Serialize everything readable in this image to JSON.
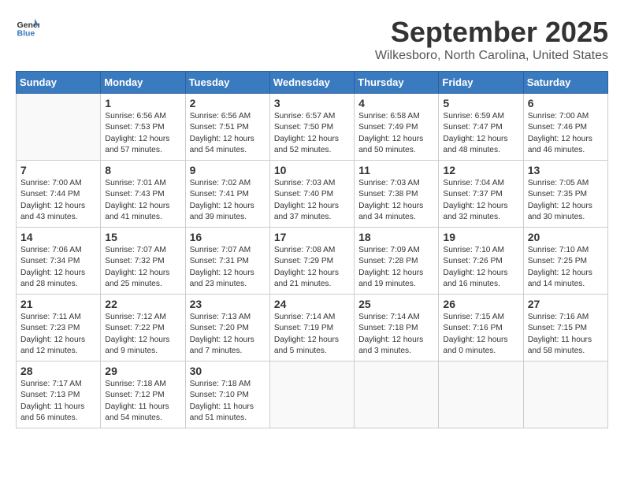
{
  "logo": {
    "general": "General",
    "blue": "Blue"
  },
  "title": "September 2025",
  "location": "Wilkesboro, North Carolina, United States",
  "weekdays": [
    "Sunday",
    "Monday",
    "Tuesday",
    "Wednesday",
    "Thursday",
    "Friday",
    "Saturday"
  ],
  "weeks": [
    [
      {
        "day": "",
        "info": ""
      },
      {
        "day": "1",
        "info": "Sunrise: 6:56 AM\nSunset: 7:53 PM\nDaylight: 12 hours\nand 57 minutes."
      },
      {
        "day": "2",
        "info": "Sunrise: 6:56 AM\nSunset: 7:51 PM\nDaylight: 12 hours\nand 54 minutes."
      },
      {
        "day": "3",
        "info": "Sunrise: 6:57 AM\nSunset: 7:50 PM\nDaylight: 12 hours\nand 52 minutes."
      },
      {
        "day": "4",
        "info": "Sunrise: 6:58 AM\nSunset: 7:49 PM\nDaylight: 12 hours\nand 50 minutes."
      },
      {
        "day": "5",
        "info": "Sunrise: 6:59 AM\nSunset: 7:47 PM\nDaylight: 12 hours\nand 48 minutes."
      },
      {
        "day": "6",
        "info": "Sunrise: 7:00 AM\nSunset: 7:46 PM\nDaylight: 12 hours\nand 46 minutes."
      }
    ],
    [
      {
        "day": "7",
        "info": "Sunrise: 7:00 AM\nSunset: 7:44 PM\nDaylight: 12 hours\nand 43 minutes."
      },
      {
        "day": "8",
        "info": "Sunrise: 7:01 AM\nSunset: 7:43 PM\nDaylight: 12 hours\nand 41 minutes."
      },
      {
        "day": "9",
        "info": "Sunrise: 7:02 AM\nSunset: 7:41 PM\nDaylight: 12 hours\nand 39 minutes."
      },
      {
        "day": "10",
        "info": "Sunrise: 7:03 AM\nSunset: 7:40 PM\nDaylight: 12 hours\nand 37 minutes."
      },
      {
        "day": "11",
        "info": "Sunrise: 7:03 AM\nSunset: 7:38 PM\nDaylight: 12 hours\nand 34 minutes."
      },
      {
        "day": "12",
        "info": "Sunrise: 7:04 AM\nSunset: 7:37 PM\nDaylight: 12 hours\nand 32 minutes."
      },
      {
        "day": "13",
        "info": "Sunrise: 7:05 AM\nSunset: 7:35 PM\nDaylight: 12 hours\nand 30 minutes."
      }
    ],
    [
      {
        "day": "14",
        "info": "Sunrise: 7:06 AM\nSunset: 7:34 PM\nDaylight: 12 hours\nand 28 minutes."
      },
      {
        "day": "15",
        "info": "Sunrise: 7:07 AM\nSunset: 7:32 PM\nDaylight: 12 hours\nand 25 minutes."
      },
      {
        "day": "16",
        "info": "Sunrise: 7:07 AM\nSunset: 7:31 PM\nDaylight: 12 hours\nand 23 minutes."
      },
      {
        "day": "17",
        "info": "Sunrise: 7:08 AM\nSunset: 7:29 PM\nDaylight: 12 hours\nand 21 minutes."
      },
      {
        "day": "18",
        "info": "Sunrise: 7:09 AM\nSunset: 7:28 PM\nDaylight: 12 hours\nand 19 minutes."
      },
      {
        "day": "19",
        "info": "Sunrise: 7:10 AM\nSunset: 7:26 PM\nDaylight: 12 hours\nand 16 minutes."
      },
      {
        "day": "20",
        "info": "Sunrise: 7:10 AM\nSunset: 7:25 PM\nDaylight: 12 hours\nand 14 minutes."
      }
    ],
    [
      {
        "day": "21",
        "info": "Sunrise: 7:11 AM\nSunset: 7:23 PM\nDaylight: 12 hours\nand 12 minutes."
      },
      {
        "day": "22",
        "info": "Sunrise: 7:12 AM\nSunset: 7:22 PM\nDaylight: 12 hours\nand 9 minutes."
      },
      {
        "day": "23",
        "info": "Sunrise: 7:13 AM\nSunset: 7:20 PM\nDaylight: 12 hours\nand 7 minutes."
      },
      {
        "day": "24",
        "info": "Sunrise: 7:14 AM\nSunset: 7:19 PM\nDaylight: 12 hours\nand 5 minutes."
      },
      {
        "day": "25",
        "info": "Sunrise: 7:14 AM\nSunset: 7:18 PM\nDaylight: 12 hours\nand 3 minutes."
      },
      {
        "day": "26",
        "info": "Sunrise: 7:15 AM\nSunset: 7:16 PM\nDaylight: 12 hours\nand 0 minutes."
      },
      {
        "day": "27",
        "info": "Sunrise: 7:16 AM\nSunset: 7:15 PM\nDaylight: 11 hours\nand 58 minutes."
      }
    ],
    [
      {
        "day": "28",
        "info": "Sunrise: 7:17 AM\nSunset: 7:13 PM\nDaylight: 11 hours\nand 56 minutes."
      },
      {
        "day": "29",
        "info": "Sunrise: 7:18 AM\nSunset: 7:12 PM\nDaylight: 11 hours\nand 54 minutes."
      },
      {
        "day": "30",
        "info": "Sunrise: 7:18 AM\nSunset: 7:10 PM\nDaylight: 11 hours\nand 51 minutes."
      },
      {
        "day": "",
        "info": ""
      },
      {
        "day": "",
        "info": ""
      },
      {
        "day": "",
        "info": ""
      },
      {
        "day": "",
        "info": ""
      }
    ]
  ]
}
